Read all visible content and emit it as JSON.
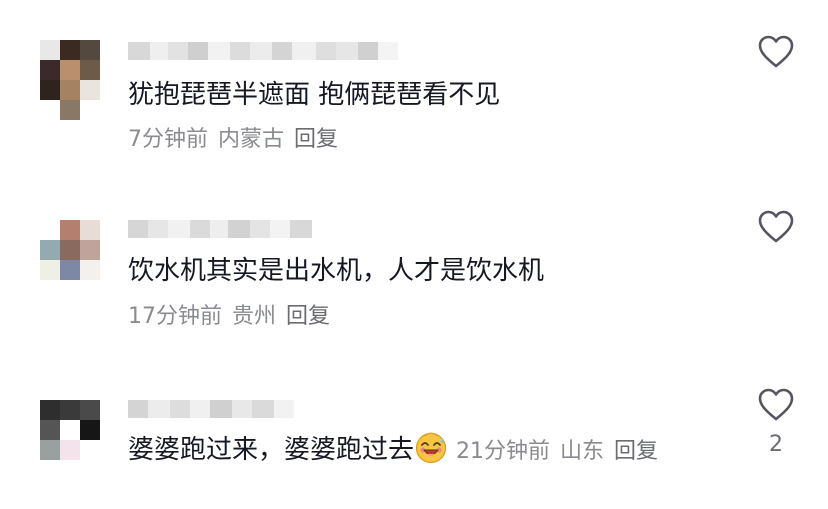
{
  "comments": [
    {
      "text": "犹抱琵琶半遮面 抱俩琵琶看不见",
      "time": "7分钟前",
      "location": "内蒙古",
      "reply": "回复",
      "like_count": ""
    },
    {
      "text": "饮水机其实是出水机，人才是饮水机",
      "time": "17分钟前",
      "location": "贵州",
      "reply": "回复",
      "like_count": ""
    },
    {
      "text": "婆婆跑过来，婆婆跑过去",
      "time": "21分钟前",
      "location": "山东",
      "reply": "回复",
      "like_count": "2",
      "emoji": "laughing-sweat-emoji"
    }
  ],
  "icons": {
    "like": "heart-outline-icon"
  },
  "colors": {
    "text": "#161823",
    "meta": "#8a8b91",
    "reply": "#6b6c72"
  }
}
